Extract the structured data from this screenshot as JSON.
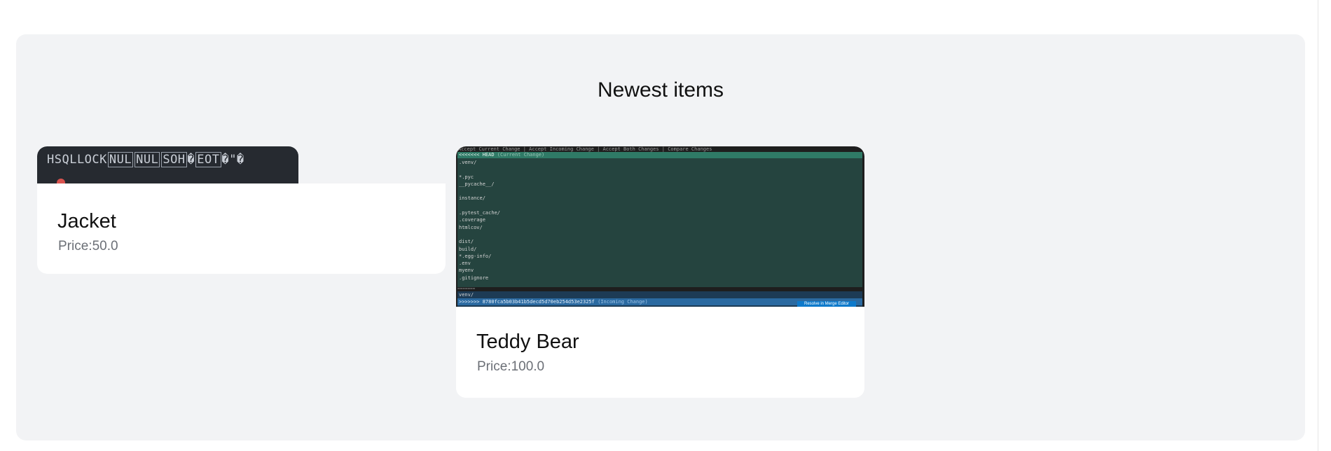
{
  "section": {
    "title": "Newest items"
  },
  "items": [
    {
      "name": "Jacket",
      "price": "Price:50.0",
      "thumbnail": {
        "segments": [
          {
            "text": "HSQLLOCK",
            "boxed": false
          },
          {
            "text": "NUL",
            "boxed": true
          },
          {
            "text": "NUL",
            "boxed": true
          },
          {
            "text": "SOH",
            "boxed": true
          },
          {
            "text": "�",
            "boxed": false
          },
          {
            "text": "EOT",
            "boxed": true
          },
          {
            "text": "�\"�",
            "boxed": false
          }
        ]
      }
    },
    {
      "name": "Teddy Bear",
      "price": "Price:100.0",
      "thumbnail": {
        "codelens": "Accept Current Change | Accept Incoming Change | Accept Both Changes | Compare Changes",
        "head_marker": "<<<<<<< HEAD",
        "head_hint": "(Current Change)",
        "current_lines": ".venv/\n\n*.pyc\n__pycache__/\n\ninstance/\n\n.pytest_cache/\n.coverage\nhtmlcov/\n\ndist/\nbuild/\n*.egg-info/\n.env\nmyenv\n.gitignore",
        "separator": "=======",
        "incoming_first": "venv/",
        "incoming_marker": ">>>>>>> 8780fca5b03b41b5decd5d70eb254d53e2325f",
        "incoming_hint": "(Incoming Change)",
        "resolve_label": "Resolve in Merge Editor"
      }
    }
  ],
  "colors": {
    "panel_bg": "#f2f3f5",
    "card_bg": "#ffffff",
    "price_text": "#6b6f76",
    "current_change_bg": "#25443f",
    "incoming_change_bg": "#2b6aa1",
    "resolve_button_bg": "#0e7acb"
  }
}
